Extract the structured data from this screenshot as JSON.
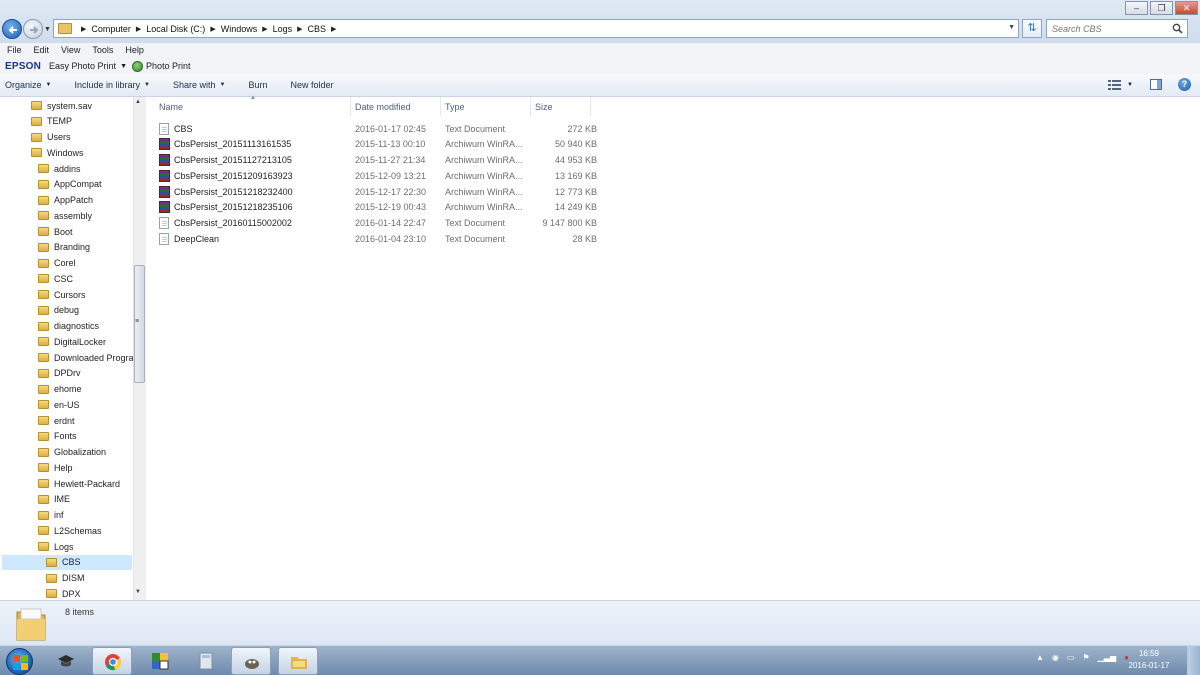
{
  "window": {
    "min_icon": "minimize-icon",
    "max_icon": "maximize-icon",
    "close_icon": "close-icon"
  },
  "address": {
    "breadcrumbs": [
      "Computer",
      "Local Disk (C:)",
      "Windows",
      "Logs",
      "CBS"
    ]
  },
  "search": {
    "placeholder": "Search CBS"
  },
  "menu": [
    "File",
    "Edit",
    "View",
    "Tools",
    "Help"
  ],
  "epson": {
    "logo": "EPSON",
    "easy_photo_print": "Easy Photo Print",
    "photo_print": "Photo Print"
  },
  "commands": {
    "organize": "Organize",
    "include_in_library": "Include in library",
    "share_with": "Share with",
    "burn": "Burn",
    "new_folder": "New folder"
  },
  "nav": {
    "items": [
      {
        "label": "system.sav",
        "indent": 1
      },
      {
        "label": "TEMP",
        "indent": 1
      },
      {
        "label": "Users",
        "indent": 1
      },
      {
        "label": "Windows",
        "indent": 1
      },
      {
        "label": "addins",
        "indent": 2
      },
      {
        "label": "AppCompat",
        "indent": 2
      },
      {
        "label": "AppPatch",
        "indent": 2
      },
      {
        "label": "assembly",
        "indent": 2
      },
      {
        "label": "Boot",
        "indent": 2
      },
      {
        "label": "Branding",
        "indent": 2
      },
      {
        "label": "Corel",
        "indent": 2
      },
      {
        "label": "CSC",
        "indent": 2
      },
      {
        "label": "Cursors",
        "indent": 2
      },
      {
        "label": "debug",
        "indent": 2
      },
      {
        "label": "diagnostics",
        "indent": 2
      },
      {
        "label": "DigitalLocker",
        "indent": 2
      },
      {
        "label": "Downloaded Progra",
        "indent": 2
      },
      {
        "label": "DPDrv",
        "indent": 2
      },
      {
        "label": "ehome",
        "indent": 2
      },
      {
        "label": "en-US",
        "indent": 2
      },
      {
        "label": "erdnt",
        "indent": 2
      },
      {
        "label": "Fonts",
        "indent": 2
      },
      {
        "label": "Globalization",
        "indent": 2
      },
      {
        "label": "Help",
        "indent": 2
      },
      {
        "label": "Hewlett-Packard",
        "indent": 2
      },
      {
        "label": "IME",
        "indent": 2
      },
      {
        "label": "inf",
        "indent": 2
      },
      {
        "label": "L2Schemas",
        "indent": 2
      },
      {
        "label": "Logs",
        "indent": 2
      },
      {
        "label": "CBS",
        "indent": 3
      },
      {
        "label": "DISM",
        "indent": 3
      },
      {
        "label": "DPX",
        "indent": 3
      }
    ],
    "selected": "CBS"
  },
  "columns": {
    "name": "Name",
    "date": "Date modified",
    "type": "Type",
    "size": "Size"
  },
  "files": [
    {
      "name": "CBS",
      "date": "2016-01-17 02:45",
      "type": "Text Document",
      "size": "272 KB",
      "icon": "text-file-icon"
    },
    {
      "name": "CbsPersist_20151113161535",
      "date": "2015-11-13 00:10",
      "type": "Archiwum WinRA...",
      "size": "50 940 KB",
      "icon": "rar-archive-icon"
    },
    {
      "name": "CbsPersist_20151127213105",
      "date": "2015-11-27 21:34",
      "type": "Archiwum WinRA...",
      "size": "44 953 KB",
      "icon": "rar-archive-icon"
    },
    {
      "name": "CbsPersist_20151209163923",
      "date": "2015-12-09 13:21",
      "type": "Archiwum WinRA...",
      "size": "13 169 KB",
      "icon": "rar-archive-icon"
    },
    {
      "name": "CbsPersist_20151218232400",
      "date": "2015-12-17 22:30",
      "type": "Archiwum WinRA...",
      "size": "12 773 KB",
      "icon": "rar-archive-icon"
    },
    {
      "name": "CbsPersist_20151218235106",
      "date": "2015-12-19 00:43",
      "type": "Archiwum WinRA...",
      "size": "14 249 KB",
      "icon": "rar-archive-icon"
    },
    {
      "name": "CbsPersist_20160115002002",
      "date": "2016-01-14 22:47",
      "type": "Text Document",
      "size": "9 147 800 KB",
      "icon": "text-file-icon"
    },
    {
      "name": "DeepClean",
      "date": "2016-01-04 23:10",
      "type": "Text Document",
      "size": "28 KB",
      "icon": "text-file-icon"
    }
  ],
  "details": {
    "count": "8 items"
  },
  "clock": {
    "time": "16:59",
    "date": "2016-01-17"
  },
  "colors": {
    "selection": "#cde8ff",
    "accent": "#1659a8",
    "folder": "#e8c468"
  }
}
